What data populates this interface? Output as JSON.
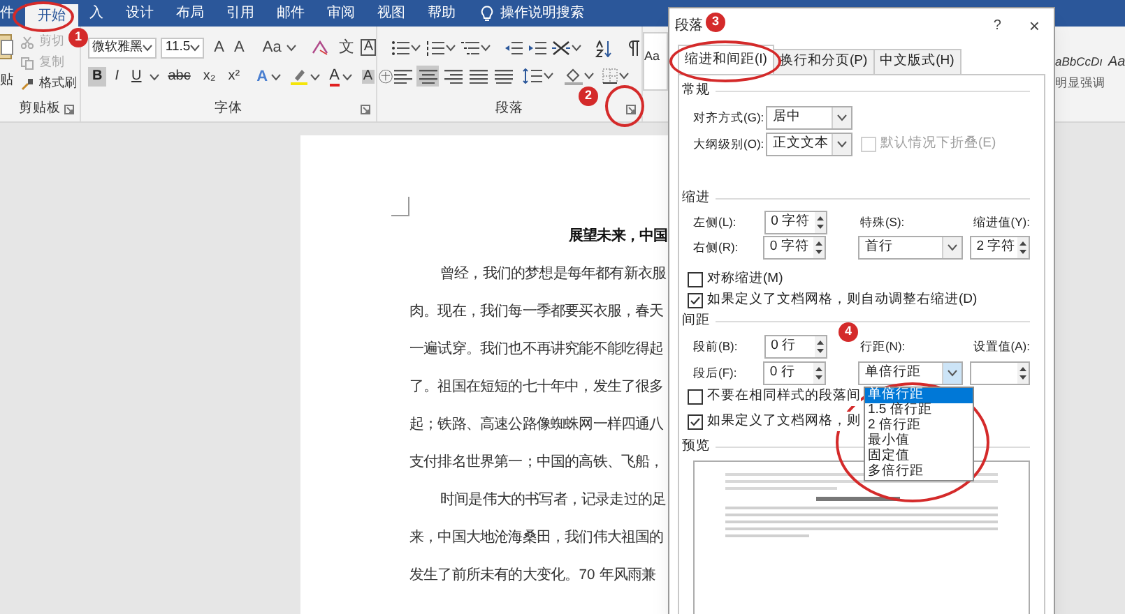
{
  "ribbon_tabs": [
    {
      "label": "件",
      "selected": false
    },
    {
      "label": "开始",
      "selected": true
    },
    {
      "label": "入",
      "selected": false
    },
    {
      "label": "设计",
      "selected": false
    },
    {
      "label": "布局",
      "selected": false
    },
    {
      "label": "引用",
      "selected": false
    },
    {
      "label": "邮件",
      "selected": false
    },
    {
      "label": "审阅",
      "selected": false
    },
    {
      "label": "视图",
      "selected": false
    },
    {
      "label": "帮助",
      "selected": false
    }
  ],
  "tell_me": "操作说明搜索",
  "clipboard": {
    "paste": "贴",
    "cut": "剪切",
    "copy": "复制",
    "format_painter": "格式刷",
    "group_label": "剪贴板"
  },
  "font": {
    "name": "微软雅黑",
    "size": "11.5",
    "grow": "A",
    "shrink": "A",
    "change_case": "Aa",
    "phonetic": "文",
    "char_border": "A",
    "format": [
      {
        "label": "B",
        "selected": true
      },
      {
        "label": "I",
        "selected": false
      },
      {
        "label": "U",
        "selected": false
      },
      {
        "label": "abc",
        "selected": false
      },
      {
        "label": "x₂",
        "selected": false
      },
      {
        "label": "x²",
        "selected": false
      }
    ],
    "effects": "A",
    "font_color": "A",
    "char_shading": "A",
    "enclosed": "㊉",
    "group_label": "字体"
  },
  "paragraph": {
    "align_buttons": [
      {
        "selected": false
      },
      {
        "selected": true
      },
      {
        "selected": false
      },
      {
        "selected": false
      },
      {
        "selected": false
      }
    ],
    "group_label": "段落"
  },
  "styles": {
    "left_sample": "Aa",
    "right_sample": "aBbCcDı",
    "right_sample_2": "Aa",
    "style_name": "明显强调"
  },
  "annotations": [
    {
      "number": "1"
    },
    {
      "number": "2"
    },
    {
      "number": "3"
    },
    {
      "number": "4"
    }
  ],
  "document": {
    "lines": [
      {
        "kind": "heading",
        "text": "展望未来，中国"
      },
      {
        "kind": "first_line",
        "text": "曾经，我们的梦想是每年都有新衣服"
      },
      {
        "kind": "line",
        "text": "肉。现在，我们每一季都要买衣服，春天"
      },
      {
        "kind": "line",
        "text": "一遍试穿。我们也不再讲究能不能吃得起"
      },
      {
        "kind": "line",
        "text": "了。祖国在短短的七十年中，发生了很多"
      },
      {
        "kind": "line",
        "text": "起；铁路、高速公路像蜘蛛网一样四通八"
      },
      {
        "kind": "line",
        "text": "支付排名世界第一；中国的高铁、飞船，"
      },
      {
        "kind": "first_line",
        "text": "时间是伟大的书写者，记录走过的足"
      },
      {
        "kind": "line",
        "text": "来，中国大地沧海桑田，我们伟大祖国的"
      },
      {
        "kind": "line",
        "text": "发生了前所未有的大变化。70 年风雨兼"
      }
    ]
  },
  "dialog": {
    "title": "段落",
    "help": "?",
    "close": "×",
    "tabs": [
      {
        "label": "缩进和间距(I)",
        "selected": true
      },
      {
        "label": "换行和分页(P)",
        "selected": false
      },
      {
        "label": "中文版式(H)",
        "selected": false
      }
    ],
    "general": {
      "heading": "常规",
      "alignment_label": "对齐方式(G):",
      "alignment": "居中",
      "outline_label": "大纲级别(O):",
      "outline": "正文文本",
      "collapse": {
        "label": "默认情况下折叠(E)",
        "checked": false,
        "disabled": true
      }
    },
    "indent": {
      "heading": "缩进",
      "left_label": "左侧(L):",
      "left": "0 字符",
      "right_label": "右侧(R):",
      "right": "0 字符",
      "special_label": "特殊(S):",
      "special": "首行",
      "by_label": "缩进值(Y):",
      "by": "2 字符",
      "mirror": {
        "label": "对称缩进(M)",
        "checked": false,
        "disabled": false
      },
      "auto_adjust": {
        "label": "如果定义了文档网格，则自动调整右缩进(D)",
        "checked": true,
        "disabled": false
      }
    },
    "spacing": {
      "heading": "间距",
      "before_label": "段前(B):",
      "before": "0 行",
      "after_label": "段后(F):",
      "after": "0 行",
      "line_label": "行距(N):",
      "line": "单倍行距",
      "at_label": "设置值(A):",
      "no_space": {
        "label": "不要在相同样式的段落间",
        "checked": false,
        "disabled": false
      },
      "snap": {
        "label": "如果定义了文档网格，则",
        "checked": true,
        "disabled": false
      },
      "options": [
        {
          "label": "单倍行距",
          "selected": true
        },
        {
          "label": "1.5 倍行距",
          "selected": false
        },
        {
          "label": "2 倍行距",
          "selected": false
        },
        {
          "label": "最小值",
          "selected": false
        },
        {
          "label": "固定值",
          "selected": false
        },
        {
          "label": "多倍行距",
          "selected": false
        }
      ]
    },
    "preview": {
      "heading": "预览"
    }
  }
}
